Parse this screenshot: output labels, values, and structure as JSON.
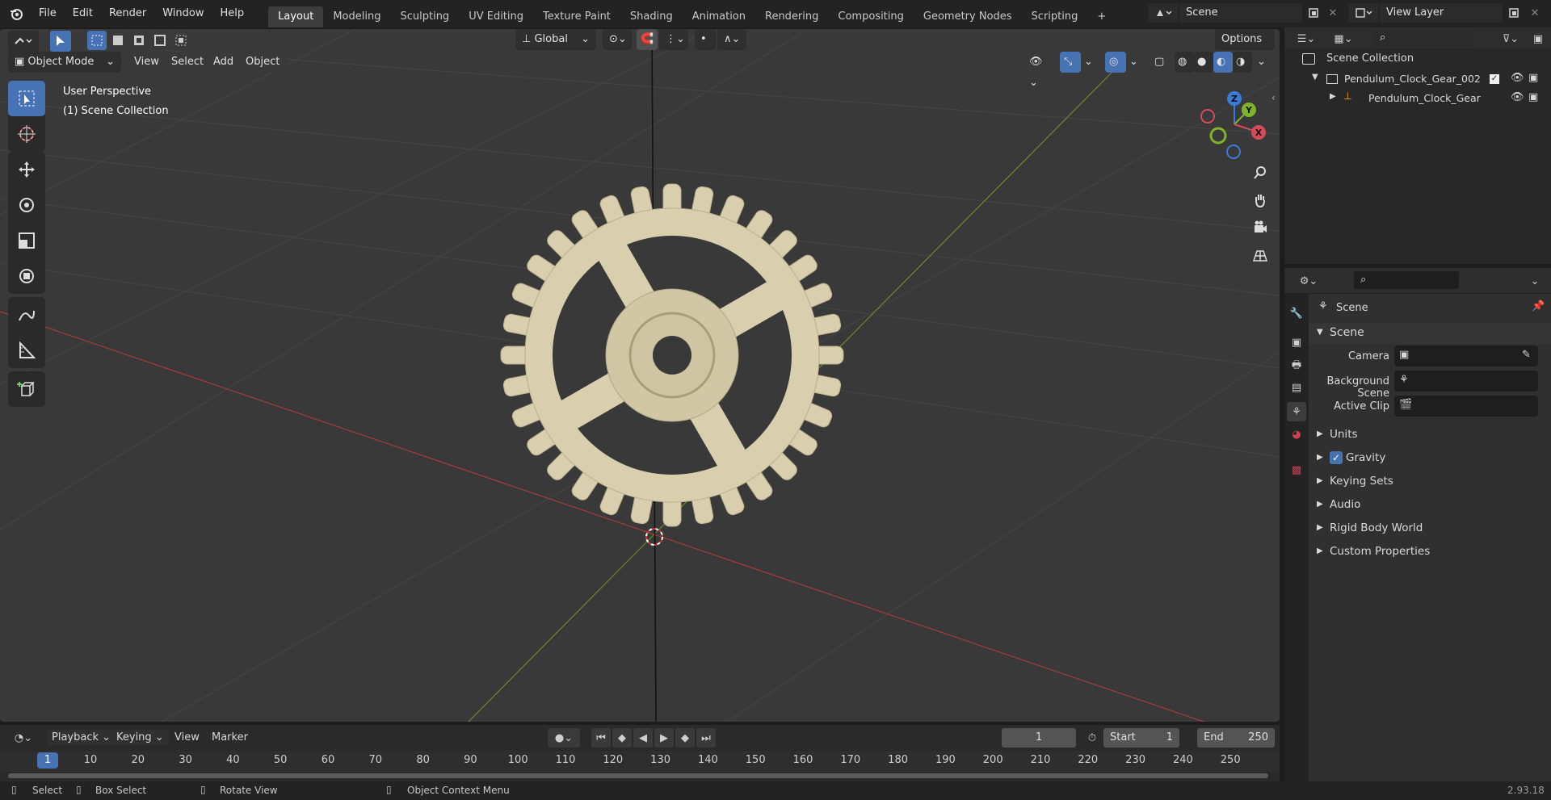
{
  "topbar": {
    "menus": [
      "File",
      "Edit",
      "Render",
      "Window",
      "Help"
    ],
    "workspaces": [
      "Layout",
      "Modeling",
      "Sculpting",
      "UV Editing",
      "Texture Paint",
      "Shading",
      "Animation",
      "Rendering",
      "Compositing",
      "Geometry Nodes",
      "Scripting"
    ],
    "active_workspace": "Layout",
    "scene_name": "Scene",
    "view_layer": "View Layer"
  },
  "viewport": {
    "transform_orientation": "Global",
    "options_label": "Options",
    "mode": "Object Mode",
    "header_menus": [
      "View",
      "Select",
      "Add",
      "Object"
    ],
    "perspective_label": "User Perspective",
    "collection_label": "(1) Scene Collection",
    "gizmo_axes": {
      "z": "Z",
      "y": "Y",
      "x": "X"
    },
    "object_color": "#d9cfae"
  },
  "outliner": {
    "root": "Scene Collection",
    "items": [
      {
        "label": "Pendulum_Clock_Gear_002"
      },
      {
        "label": "Pendulum_Clock_Gear"
      }
    ]
  },
  "properties": {
    "header": "Scene",
    "section": "Scene",
    "fields": [
      {
        "label": "Camera"
      },
      {
        "label": "Background Scene"
      },
      {
        "label": "Active Clip"
      }
    ],
    "panels": [
      "Units",
      "Gravity",
      "Keying Sets",
      "Audio",
      "Rigid Body World",
      "Custom Properties"
    ],
    "gravity_checked": true
  },
  "timeline": {
    "menus": [
      "Playback",
      "Keying",
      "View",
      "Marker"
    ],
    "current_frame": "1",
    "start_label": "Start",
    "start_value": "1",
    "end_label": "End",
    "end_value": "250",
    "ruler": [
      "1",
      "10",
      "20",
      "30",
      "40",
      "50",
      "60",
      "70",
      "80",
      "90",
      "100",
      "110",
      "120",
      "130",
      "140",
      "150",
      "160",
      "170",
      "180",
      "190",
      "200",
      "210",
      "220",
      "230",
      "240",
      "250"
    ]
  },
  "statusbar": {
    "select": "Select",
    "box_select": "Box Select",
    "rotate_view": "Rotate View",
    "context_menu": "Object Context Menu",
    "version": "2.93.18"
  }
}
